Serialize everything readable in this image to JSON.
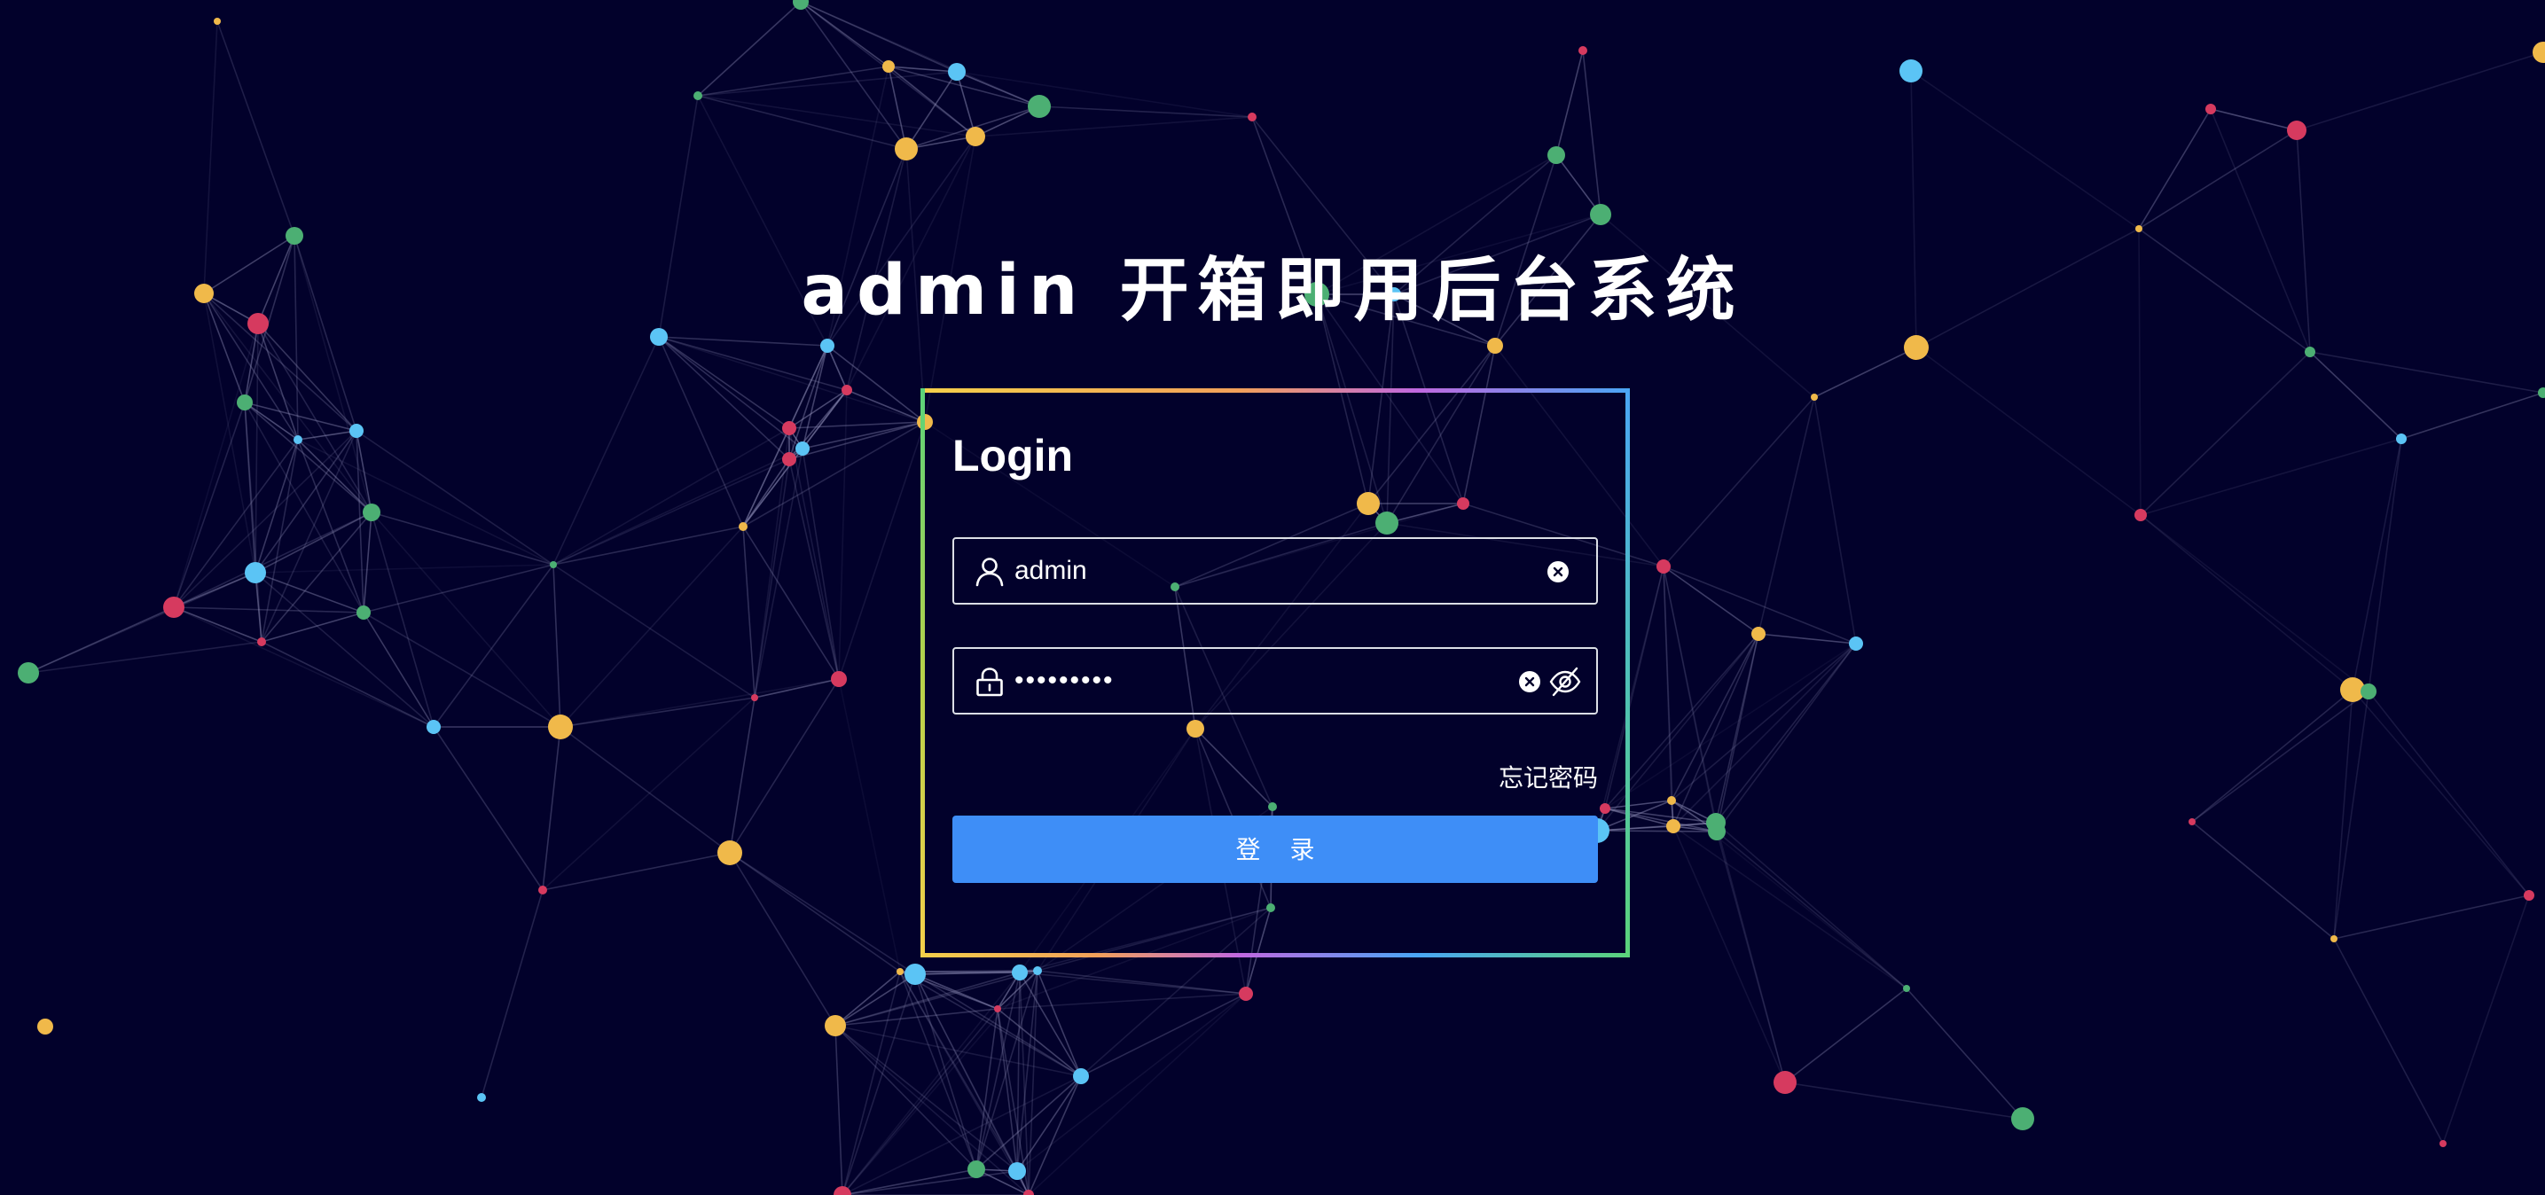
{
  "page": {
    "title": "admin 开箱即用后台系统"
  },
  "login_form": {
    "heading": "Login",
    "username": {
      "value": "admin",
      "icon": "user-icon",
      "clear_icon": "clear-icon"
    },
    "password": {
      "value": "•••••••••",
      "icon": "lock-icon",
      "clear_icon": "clear-icon",
      "toggle_icon": "eye-off-icon"
    },
    "forgot_password": "忘记密码",
    "submit_label": "登 录"
  },
  "theme": {
    "background": "#02012b",
    "primary": "#3e8ef7",
    "particle_colors": [
      "#f0b94a",
      "#5bc4f5",
      "#4caf73",
      "#d63a5f"
    ],
    "border_gradient": [
      "#f5d04a",
      "#f29a5a",
      "#c068e0",
      "#4aa6f5",
      "#5bd37a"
    ]
  }
}
